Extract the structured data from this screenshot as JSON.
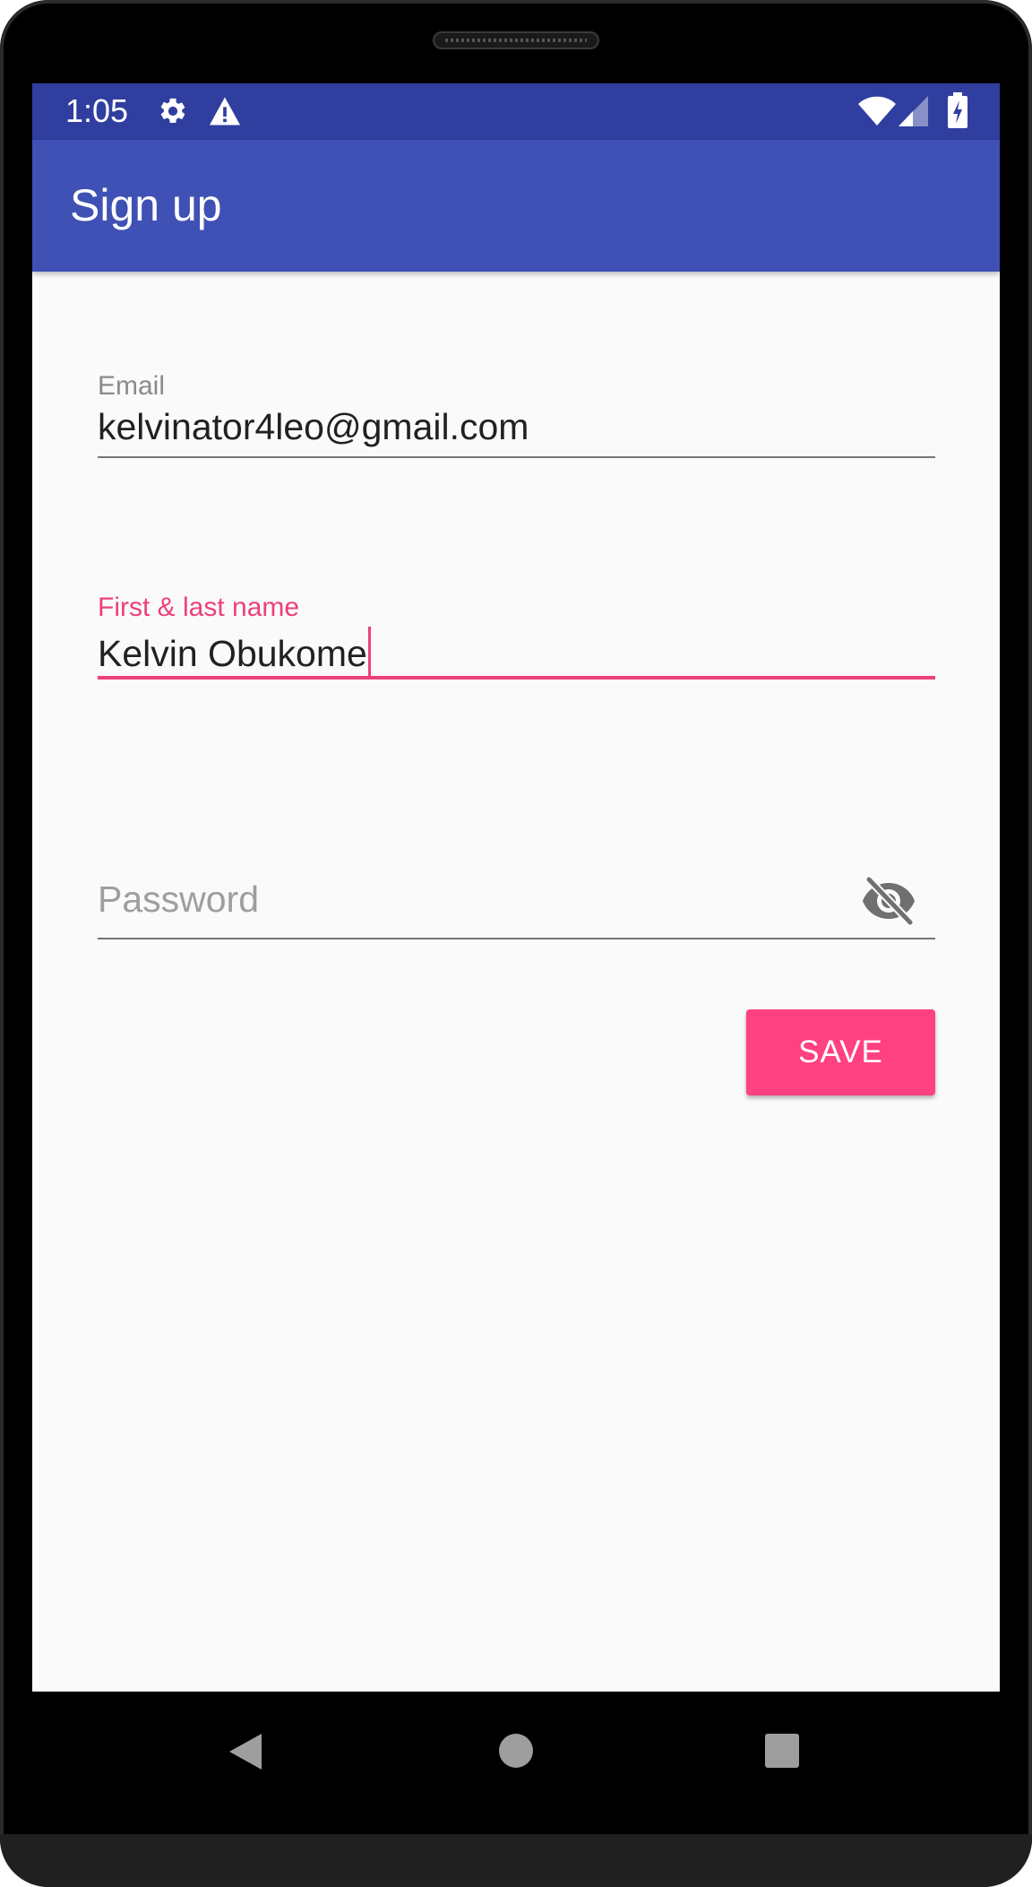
{
  "status_bar": {
    "time": "1:05",
    "left_icons": [
      "gear-icon",
      "warning-icon"
    ],
    "right_icons": [
      "wifi-icon",
      "cell-signal-icon",
      "battery-charging-icon"
    ],
    "color": "#303f9f"
  },
  "app_bar": {
    "title": "Sign up",
    "color": "#3f51b5"
  },
  "form": {
    "email": {
      "label": "Email",
      "value": "kelvinator4leo@gmail.com"
    },
    "name": {
      "label": "First & last name",
      "value": "Kelvin Obukome",
      "focused": true
    },
    "password": {
      "placeholder": "Password",
      "value": "",
      "toggle_icon": "visibility-off-icon"
    },
    "save_label": "SAVE"
  },
  "colors": {
    "accent": "#ff4081",
    "focus": "#ec407a"
  },
  "nav_bar": {
    "buttons": [
      "back-icon",
      "home-icon",
      "recents-icon"
    ]
  }
}
